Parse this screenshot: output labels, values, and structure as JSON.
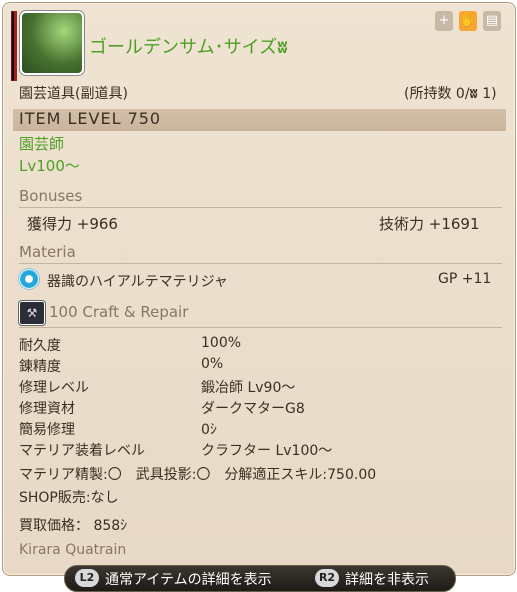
{
  "item": {
    "name": "ゴールデンサム･サイズ",
    "hq_symbol": "ʬ",
    "category": "園芸道具(副道具)",
    "owned": "(所持数 0/",
    "owned_hq_count": " 1)",
    "item_level": "ITEM LEVEL 750",
    "job": "園芸師",
    "level": "Lv100～"
  },
  "bonuses": {
    "heading": "Bonuses",
    "left": "獲得力 +966",
    "right": "技術力 +1691"
  },
  "materia": {
    "heading": "Materia",
    "name": "器識のハイアルテマテリジャ",
    "value": "GP +11"
  },
  "repair": {
    "heading": "100 Craft & Repair",
    "rows": [
      {
        "label": "耐久度",
        "value": "100%"
      },
      {
        "label": "錬精度",
        "value": "0%"
      },
      {
        "label": "修理レベル",
        "value": "鍛冶師 Lv90～"
      },
      {
        "label": "修理資材",
        "value": "ダークマターG8"
      },
      {
        "label": "簡易修理",
        "value": "0ｼ"
      },
      {
        "label": "マテリア装着レベル",
        "value": "クラフター Lv100～"
      }
    ],
    "extra1": "マテリア精製:〇　武具投影:〇　分解適正スキル:750.00",
    "extra2": "SHOP販売:なし",
    "sell": "買取価格： 858ｼ",
    "crafter": "Kirara Quatrain"
  },
  "footer": {
    "l2_key": "L2",
    "l2_label": "通常アイテムの詳細を表示",
    "r2_key": "R2",
    "r2_label": "詳細を非表示"
  },
  "colors": {
    "accent_green": "#4f9f25",
    "panel_bg": "#efe3d2",
    "text": "#3c2e22"
  },
  "icons": [
    "item-icon",
    "plus-icon",
    "hand-icon",
    "market-icon",
    "materia-icon",
    "anvil-icon"
  ]
}
